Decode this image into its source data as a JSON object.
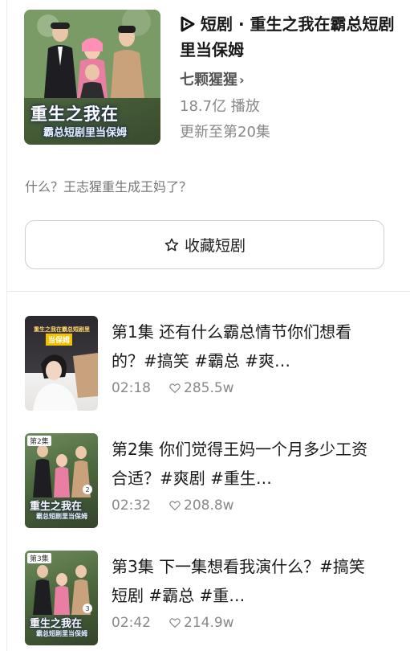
{
  "drama": {
    "category_label": "短剧",
    "title": "重生之我在霸总短剧里当保姆",
    "author": "七颗猩猩",
    "plays": "18.7亿 播放",
    "update": "更新至第20集",
    "description": "什么？王志猩重生成王妈了？",
    "cover_title": "重生之我在",
    "cover_subtitle": "霸总短剧里当保姆"
  },
  "favorite_button": {
    "label": "收藏短剧"
  },
  "episodes": [
    {
      "title": "第1集  还有什么霸总情节你们想看的？#搞笑 #霸总 #爽…",
      "duration": "02:18",
      "likes": "285.5w",
      "thumb_banner": "重生之我在霸总短剧里",
      "thumb_box": "当保姆"
    },
    {
      "title": "第2集  你们觉得王妈一个月多少工资合适？#爽剧 #重生…",
      "duration": "02:32",
      "likes": "208.8w",
      "thumb_tag": "第2集",
      "thumb_title": "重生之我在",
      "thumb_sub": "霸总短剧里当保姆"
    },
    {
      "title": "第3集  下一集想看我演什么？#搞笑短剧 #霸总 #重…",
      "duration": "02:42",
      "likes": "214.9w",
      "thumb_tag": "第3集",
      "thumb_title": "重生之我在",
      "thumb_sub": "霸总短剧里当保姆"
    }
  ],
  "icons": {
    "play": "play-logo-icon",
    "chevron": "chevron-right-icon",
    "star": "star-outline-icon",
    "heart": "heart-outline-icon"
  }
}
